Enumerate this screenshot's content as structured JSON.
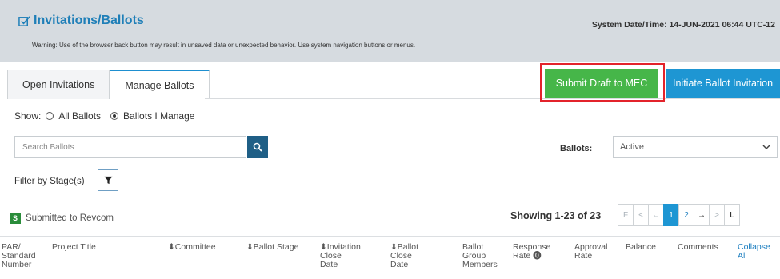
{
  "header": {
    "title": "Invitations/Ballots",
    "warning": "Warning: Use of the browser back button may result in unsaved data or unexpected behavior. Use system navigation buttons or menus.",
    "system_datetime": "System Date/Time: 14-JUN-2021  06:44 UTC-12"
  },
  "tabs": [
    {
      "label": "Open Invitations",
      "active": false
    },
    {
      "label": "Manage Ballots",
      "active": true
    }
  ],
  "actions": {
    "submit_draft": "Submit Draft to MEC",
    "initiate": "Initiate Ballot Invitation"
  },
  "show": {
    "label": "Show:",
    "options": [
      "All Ballots",
      "Ballots I Manage"
    ],
    "selected": "Ballots I Manage"
  },
  "search": {
    "placeholder": "Search Ballots"
  },
  "ballots_filter": {
    "label": "Ballots:",
    "value": "Active"
  },
  "filter_stage": {
    "label": "Filter by Stage(s)"
  },
  "legend": {
    "badge": "S",
    "text": "Submitted to Revcom"
  },
  "showing": "Showing 1-23 of 23",
  "pager": [
    "F",
    "<",
    "←",
    "1",
    "2",
    "→",
    ">",
    "L"
  ],
  "columns": [
    "PAR/\nStandard\nNumber",
    "Project Title",
    "⬍Committee",
    "⬍Ballot Stage",
    "⬍Invitation\nClose\nDate",
    "⬍Ballot\nClose\nDate",
    "Ballot\nGroup\nMembers",
    "Response\nRate ⓿",
    "Approval\nRate",
    "Balance",
    "Comments",
    "Collapse\nAll"
  ],
  "colors": {
    "header_bg": "#d6dbe0",
    "title": "#1f7fb8",
    "submit_green": "#46b649",
    "initiate_blue": "#1e96d3",
    "highlight_red": "#e3232b"
  }
}
